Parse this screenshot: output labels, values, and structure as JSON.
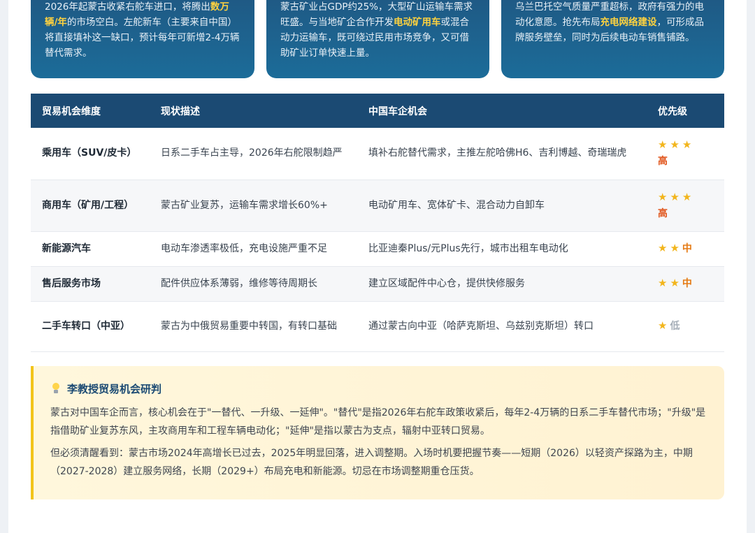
{
  "cards": [
    {
      "parts": [
        {
          "t": "2026年起蒙古收紧右舵车进口，将腾出",
          "hl": false
        },
        {
          "t": "数万辆/年",
          "hl": true
        },
        {
          "t": "的市场空白。左舵新车（主要来自中国）将直接填补这一缺口，预计每年可新增2-4万辆替代需求。",
          "hl": false
        }
      ]
    },
    {
      "parts": [
        {
          "t": "蒙古矿业占GDP约25%，大型矿山运输车需求旺盛。与当地矿企合作开发",
          "hl": false
        },
        {
          "t": "电动矿用车",
          "hl": true
        },
        {
          "t": "或混合动力运输车，既可绕过民用市场竞争，又可借助矿业订单快速上量。",
          "hl": false
        }
      ]
    },
    {
      "parts": [
        {
          "t": "乌兰巴托空气质量严重超标，政府有强力的电动化意愿。抢先布局",
          "hl": false
        },
        {
          "t": "充电网络建设",
          "hl": true
        },
        {
          "t": "，可形成品牌服务壁垒，同时为后续电动车销售铺路。",
          "hl": false
        }
      ]
    }
  ],
  "table": {
    "headers": [
      "贸易机会维度",
      "现状描述",
      "中国车企机会",
      "优先级"
    ],
    "rows": [
      {
        "dim": "乘用车（SUV/皮卡）",
        "desc": "日系二手车占主导，2026年右舵限制趋严",
        "opp": "填补右舵替代需求，主推左舵哈佛H6、吉利博越、奇瑞瑞虎",
        "stars": "★★★",
        "level": "高",
        "level_class": "lvl-high",
        "stack": true
      },
      {
        "dim": "商用车（矿用/工程）",
        "desc": "蒙古矿业复苏，运输车需求增长60%+",
        "opp": "电动矿用车、宽体矿卡、混合动力自卸车",
        "stars": "★★★",
        "level": "高",
        "level_class": "lvl-high",
        "stack": true
      },
      {
        "dim": "新能源汽车",
        "desc": "电动车渗透率极低，充电设施严重不足",
        "opp": "比亚迪秦Plus/元Plus先行，城市出租车电动化",
        "stars": "★★",
        "level": "中",
        "level_class": "lvl-mid",
        "stack": false
      },
      {
        "dim": "售后服务市场",
        "desc": "配件供应体系薄弱，维修等待周期长",
        "opp": "建立区域配件中心仓，提供快修服务",
        "stars": "★★",
        "level": "中",
        "level_class": "lvl-mid",
        "stack": false
      },
      {
        "dim": "二手车转口（中亚）",
        "desc": "蒙古为中俄贸易重要中转国，有转口基础",
        "opp": "通过蒙古向中亚（哈萨克斯坦、乌兹别克斯坦）转口",
        "stars": "★",
        "level": "低",
        "level_class": "lvl-low",
        "stack": false
      }
    ]
  },
  "note": {
    "title": "李教授贸易机会研判",
    "p1": "蒙古对中国车企而言，核心机会在于\"一替代、一升级、一延伸\"。\"替代\"是指2026年右舵车政策收紧后，每年2-4万辆的日系二手车替代市场；\"升级\"是指借助矿业复苏东风，主攻商用车和工程车辆电动化；\"延伸\"是指以蒙古为支点，辐射中亚转口贸易。",
    "p2": "但必须清醒看到：蒙古市场2024年高增长已过去，2025年明显回落，进入调整期。入场时机要把握节奏——短期（2026）以轻资产探路为主，中期（2027-2028）建立服务网络，长期（2029+）布局充电和新能源。切忌在市场调整期重仓压货。"
  },
  "colors": {
    "accent": "#1b4a73",
    "highlight": "#ffd23f",
    "high": "#e0541a",
    "mid": "#e57a14",
    "low": "#a5aeb8"
  }
}
